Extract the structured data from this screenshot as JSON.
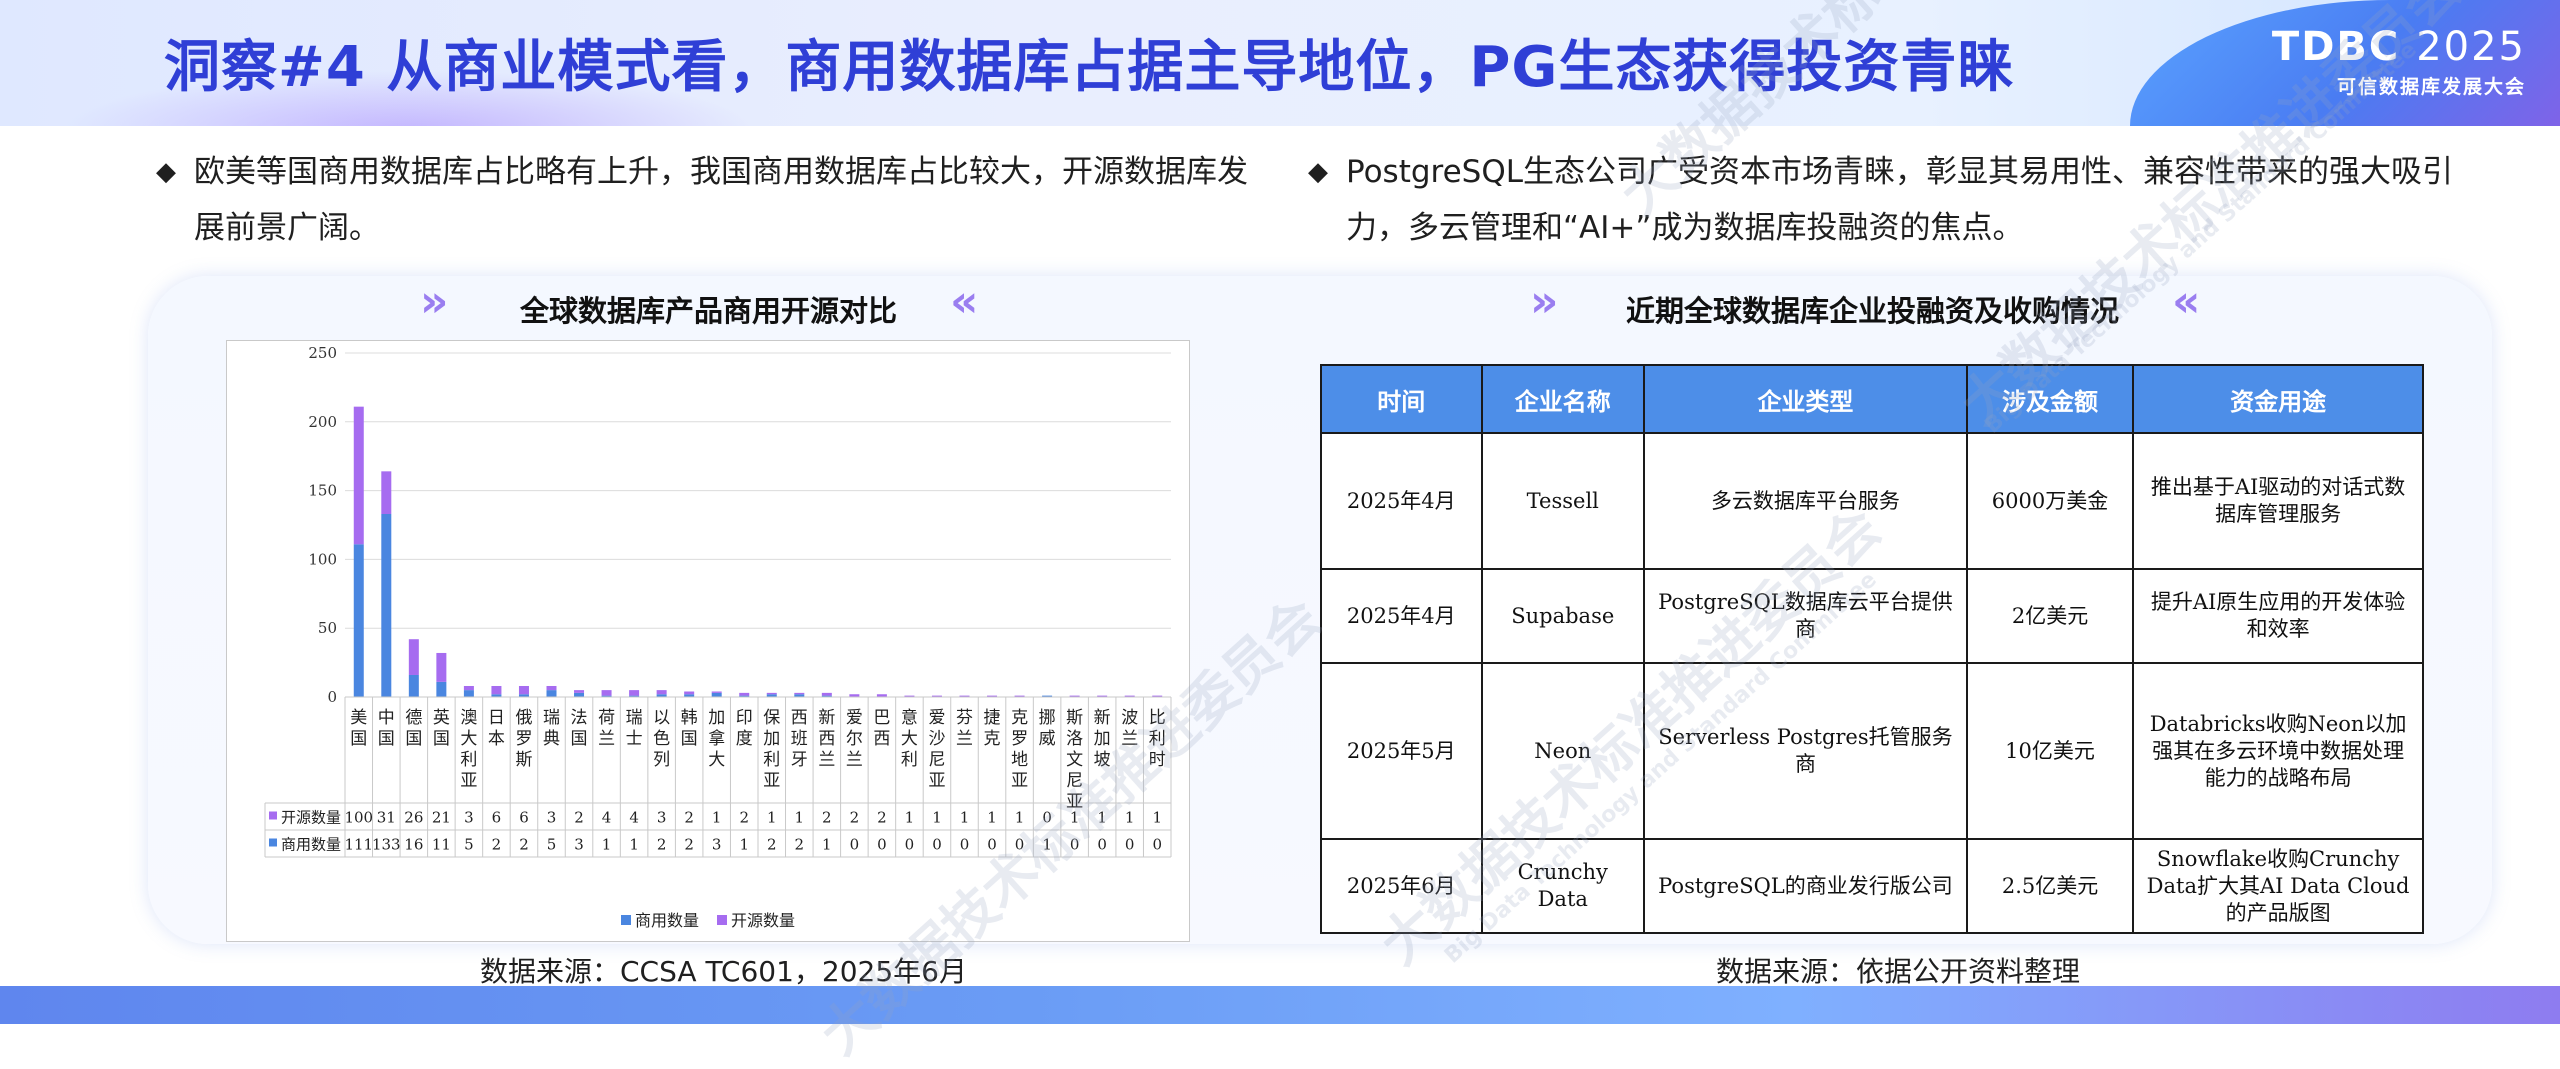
{
  "header": {
    "title": "洞察#4 从商业模式看，商用数据库占据主导地位，PG生态获得投资青睐",
    "brand_main": "TDBC",
    "brand_year": "2025",
    "brand_sub": "可信数据库发展大会"
  },
  "bullets": {
    "left": "欧美等国商用数据库占比略有上升，我国商用数据库占比较大，开源数据库发展前景广阔。",
    "right": "PostgreSQL生态公司广受资本市场青睐，彰显其易用性、兼容性带来的强大吸引力，多云管理和“AI+”成为数据库投融资的焦点。",
    "marker": "◆"
  },
  "left_section": {
    "title": "全球数据库产品商用开源对比",
    "source": "数据来源：CCSA TC601，2025年6月"
  },
  "right_section": {
    "title": "近期全球数据库企业投融资及收购情况",
    "source": "数据来源：依据公开资料整理"
  },
  "decor": {
    "chev_right": "»",
    "chev_left": "«"
  },
  "chart_data": {
    "type": "bar",
    "stacked": true,
    "categories": [
      "美国",
      "中国",
      "德国",
      "英国",
      "澳大利亚",
      "日本",
      "俄罗斯",
      "瑞典",
      "法国",
      "荷兰",
      "瑞士",
      "以色列",
      "韩国",
      "加拿大",
      "印度",
      "保加利亚",
      "西班牙",
      "新西兰",
      "爱尔兰",
      "巴西",
      "意大利",
      "爱沙尼亚",
      "芬兰",
      "捷克",
      "克罗地亚",
      "挪威",
      "斯洛文尼亚",
      "新加坡",
      "波兰",
      "比利时"
    ],
    "series": [
      {
        "name": "商用数量",
        "color": "#4a86e0",
        "values": [
          111,
          133,
          16,
          11,
          5,
          2,
          2,
          5,
          3,
          1,
          1,
          2,
          2,
          3,
          1,
          2,
          2,
          1,
          0,
          0,
          0,
          0,
          0,
          0,
          0,
          1,
          0,
          0,
          0,
          0
        ]
      },
      {
        "name": "开源数量",
        "color": "#a66cf0",
        "values": [
          100,
          31,
          26,
          21,
          3,
          6,
          6,
          3,
          2,
          4,
          4,
          3,
          2,
          1,
          2,
          1,
          1,
          2,
          2,
          2,
          1,
          1,
          1,
          1,
          1,
          0,
          1,
          1,
          1,
          1
        ]
      }
    ],
    "ylim": [
      0,
      250
    ],
    "yticks": [
      "0",
      "50",
      "100",
      "150",
      "200",
      "250"
    ],
    "grid": true,
    "legend": "bottom",
    "data_table": true
  },
  "table": {
    "headers": [
      "时间",
      "企业名称",
      "企业类型",
      "涉及金额",
      "资金用途"
    ],
    "rows": [
      [
        "2025年4月",
        "Tessell",
        "多云数据库平台服务",
        "6000万美金",
        "推出基于AI驱动的对话式数据库管理服务"
      ],
      [
        "2025年4月",
        "Supabase",
        "PostgreSQL数据库云平台提供商",
        "2亿美元",
        "提升AI原生应用的开发体验和效率"
      ],
      [
        "2025年5月",
        "Neon",
        "Serverless Postgres托管服务商",
        "10亿美元",
        "Databricks收购Neon以加强其在多云环境中数据处理能力的战略布局"
      ],
      [
        "2025年6月",
        "Crunchy Data",
        "PostgreSQL的商业发行版公司",
        "2.5亿美元",
        "Snowflake收购Crunchy Data扩大其AI Data Cloud的产品版图"
      ]
    ]
  },
  "watermark": {
    "cn": "大数据技术标准推进委员会",
    "en": "Big Data Technology and Standard Committee"
  }
}
